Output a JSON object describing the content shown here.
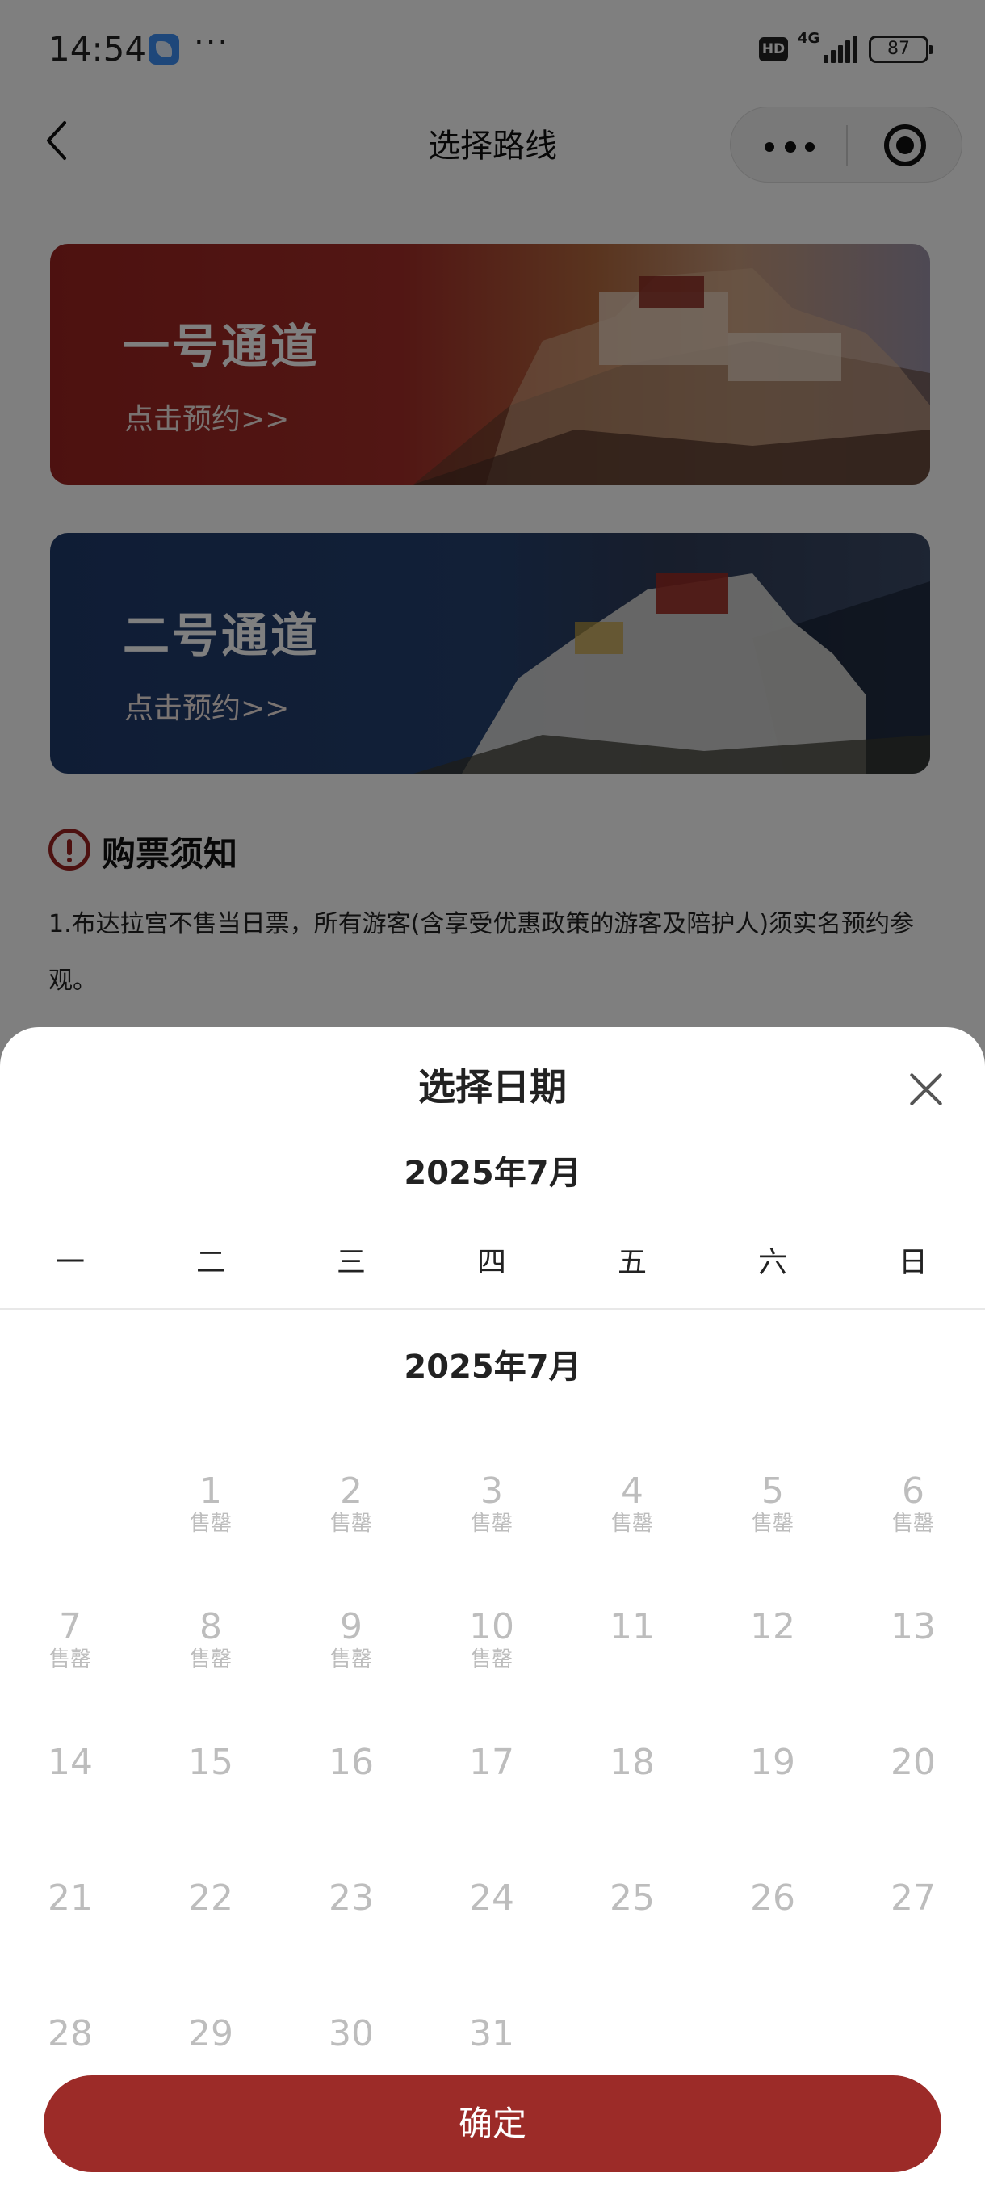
{
  "status_bar": {
    "time": "14:54",
    "more": "···",
    "hd": "HD",
    "network": "4G",
    "battery": "87"
  },
  "nav": {
    "title": "选择路线"
  },
  "routes": [
    {
      "title": "一号通道",
      "action": "点击预约>>"
    },
    {
      "title": "二号通道",
      "action": "点击预约>>"
    }
  ],
  "notice": {
    "title": "购票须知",
    "text": "1.布达拉宫不售当日票，所有游客(含享受优惠政策的游客及陪护人)须实名预约参观。"
  },
  "date_picker": {
    "title": "选择日期",
    "month_header": "2025年7月",
    "weekdays": [
      "一",
      "二",
      "三",
      "四",
      "五",
      "六",
      "日"
    ],
    "month_title": "2025年7月",
    "days": [
      {
        "n": "1",
        "s": "售罄"
      },
      {
        "n": "2",
        "s": "售罄"
      },
      {
        "n": "3",
        "s": "售罄"
      },
      {
        "n": "4",
        "s": "售罄"
      },
      {
        "n": "5",
        "s": "售罄"
      },
      {
        "n": "6",
        "s": "售罄"
      },
      {
        "n": "7",
        "s": "售罄"
      },
      {
        "n": "8",
        "s": "售罄"
      },
      {
        "n": "9",
        "s": "售罄"
      },
      {
        "n": "10",
        "s": "售罄"
      },
      {
        "n": "11",
        "s": ""
      },
      {
        "n": "12",
        "s": ""
      },
      {
        "n": "13",
        "s": ""
      },
      {
        "n": "14",
        "s": ""
      },
      {
        "n": "15",
        "s": ""
      },
      {
        "n": "16",
        "s": ""
      },
      {
        "n": "17",
        "s": ""
      },
      {
        "n": "18",
        "s": ""
      },
      {
        "n": "19",
        "s": ""
      },
      {
        "n": "20",
        "s": ""
      },
      {
        "n": "21",
        "s": ""
      },
      {
        "n": "22",
        "s": ""
      },
      {
        "n": "23",
        "s": ""
      },
      {
        "n": "24",
        "s": ""
      },
      {
        "n": "25",
        "s": ""
      },
      {
        "n": "26",
        "s": ""
      },
      {
        "n": "27",
        "s": ""
      },
      {
        "n": "28",
        "s": ""
      },
      {
        "n": "29",
        "s": ""
      },
      {
        "n": "30",
        "s": ""
      },
      {
        "n": "31",
        "s": ""
      }
    ],
    "confirm_label": "确定"
  },
  "colors": {
    "accent": "#9c2b28",
    "disabled_text": "#bdbdbd"
  }
}
